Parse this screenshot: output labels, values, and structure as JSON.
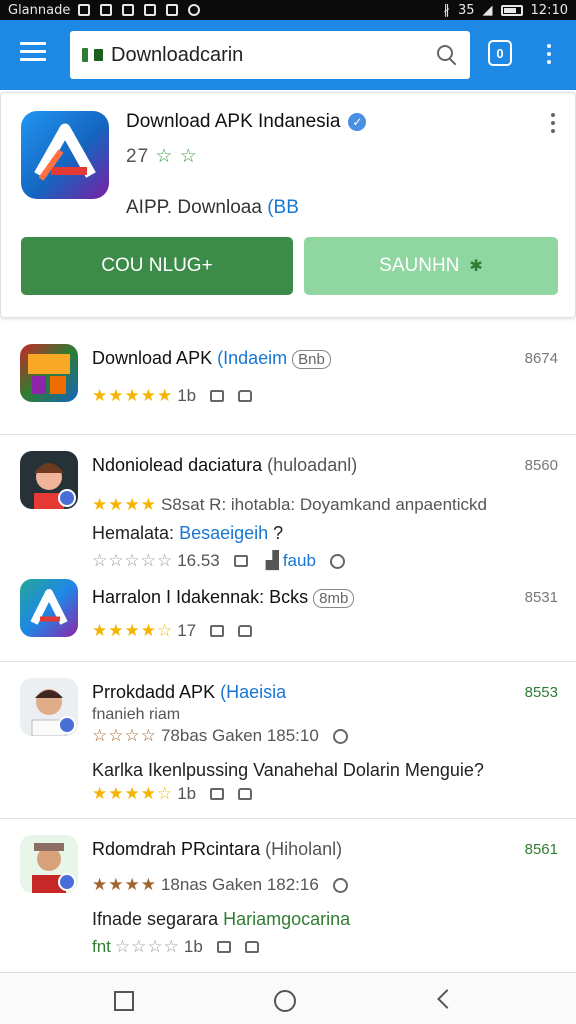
{
  "status_bar": {
    "carrier": "Glannade",
    "time": "12:10",
    "signal": "35"
  },
  "app_bar": {
    "search_value": "Downloadcarin",
    "tab_count": "0",
    "bg_color": "#1e88e5"
  },
  "featured": {
    "title": "Download APK Indanesia",
    "rating": "27",
    "subtitle_prefix": "AIPP. Downloaa",
    "subtitle_highlight": "(BB",
    "install_label": "COU NLUG+",
    "save_label": "SAUNHN"
  },
  "list": [
    {
      "title": "Download APK",
      "title_blue": "(Indaeim",
      "chip": "Bnb",
      "size": "8674",
      "rating_text": "1b"
    },
    {
      "title": "Ndoniolead daciatura",
      "title_grey": "(huloadanl)",
      "size": "8560",
      "rating_text": "S8sat R: ihotabla: Doyamkand anpaentickd",
      "desc_prefix": "Hemalata:",
      "desc_blue": "Besaeigeih",
      "desc_suffix": "?",
      "meta_text": "16.53",
      "meta_blue": "faub"
    },
    {
      "title": "Harralon I Idakennak: Bcks",
      "chip": "8mb",
      "size": "8531",
      "rating_text": "17"
    },
    {
      "title": "Prrokdadd APK",
      "title_blue": "(Haeisia",
      "size": "8553",
      "subtitle": "fnanieh riam",
      "rating_text": "78bas Gaken  185:10",
      "desc": "Karlka Ikenlpussing Vanahehal Dolarin Menguie?",
      "rating2_text": "1b"
    },
    {
      "title": "Rdomdrah PRcintara",
      "title_grey": "(Hiholanl)",
      "size": "8561",
      "rating_text": "18nas Gaken  182:16",
      "desc_prefix": "Ifnade segarara",
      "desc_green": "Hariamgocarina",
      "rating2_prefix": "fnt",
      "rating2_text": "1b"
    }
  ]
}
